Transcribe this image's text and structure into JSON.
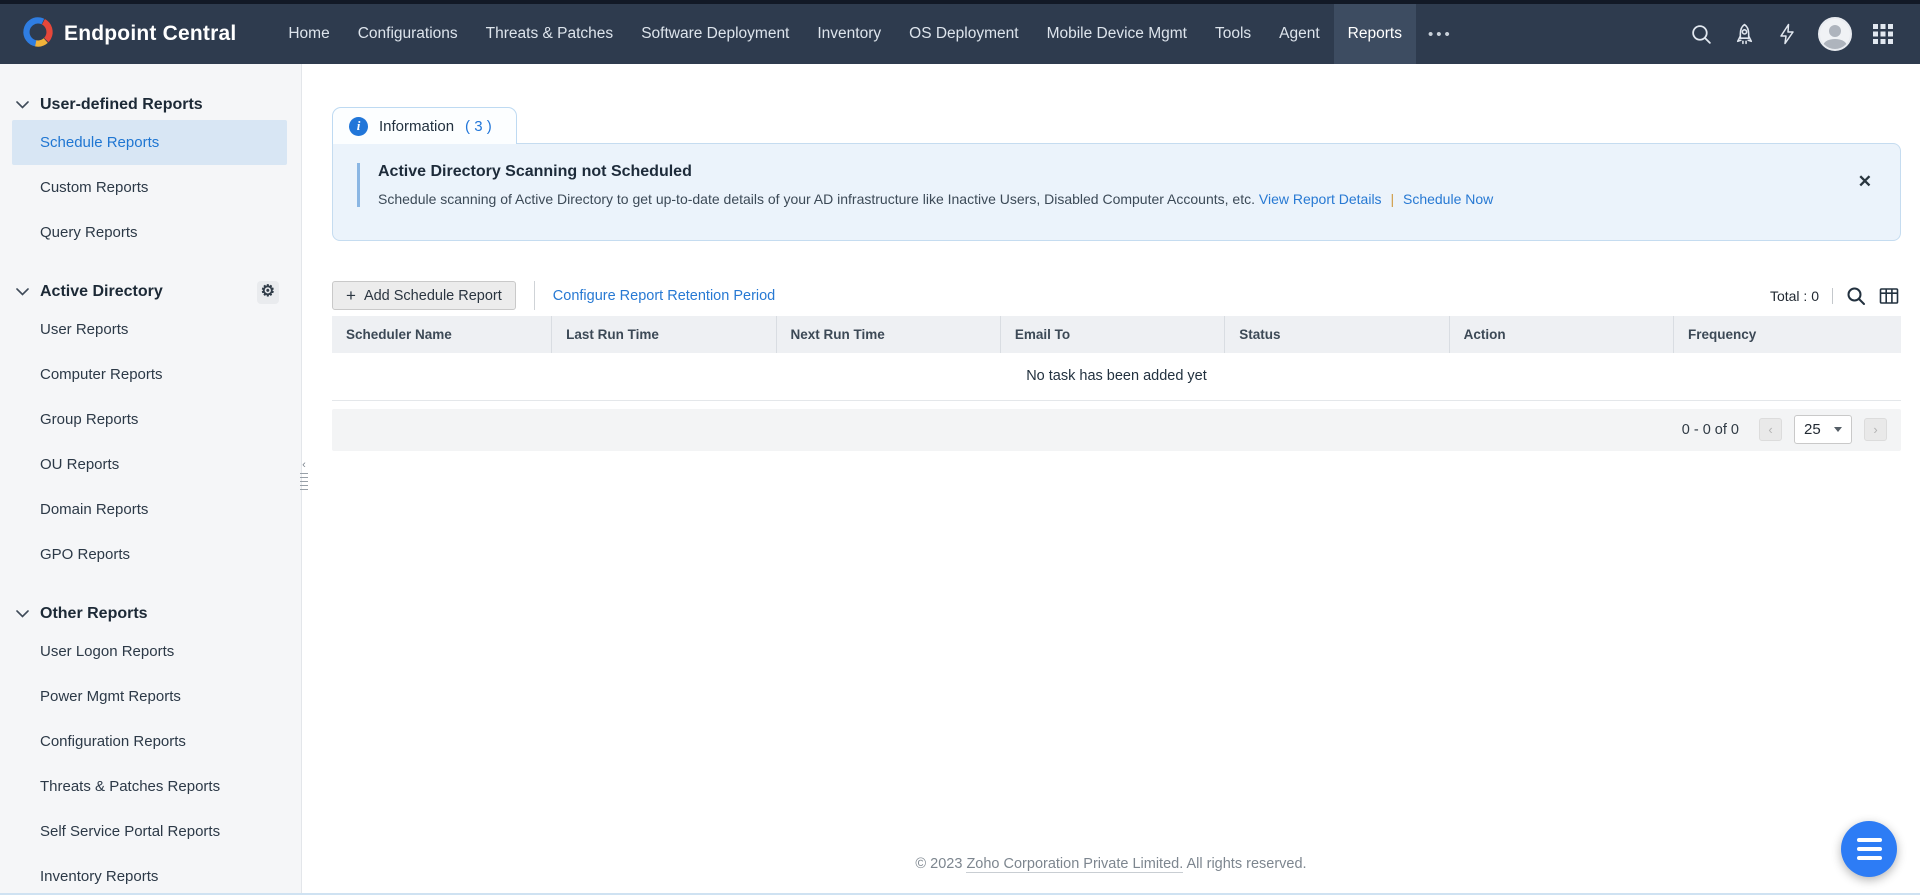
{
  "colors": {
    "nav_bg": "#2e3b4e",
    "nav_active_bg": "#3d4c61",
    "accent_blue": "#2779d3",
    "selected_item_bg": "#d8e6f4",
    "alert_bg": "#ebf3fb",
    "alert_border": "#c5dcf0",
    "info_badge_blue": "#2176d9",
    "fab_blue": "#2d7cf5"
  },
  "nav": {
    "brand": "Endpoint Central",
    "items": [
      {
        "label": "Home"
      },
      {
        "label": "Configurations"
      },
      {
        "label": "Threats & Patches"
      },
      {
        "label": "Software Deployment"
      },
      {
        "label": "Inventory"
      },
      {
        "label": "OS Deployment"
      },
      {
        "label": "Mobile Device Mgmt"
      },
      {
        "label": "Tools"
      },
      {
        "label": "Agent"
      },
      {
        "label": "Reports"
      }
    ],
    "active_item": "Reports",
    "more_label": "•••",
    "icons": [
      "search-icon",
      "rocket-icon",
      "zap-icon",
      "avatar",
      "apps-grid-icon"
    ]
  },
  "sidebar": {
    "selected": "Schedule Reports",
    "sections": [
      {
        "header": "User-defined Reports",
        "items": [
          {
            "label": "Schedule Reports"
          },
          {
            "label": "Custom Reports"
          },
          {
            "label": "Query Reports"
          }
        ]
      },
      {
        "header": "Active Directory",
        "icon": "gear-icon",
        "gear_glyph": "⚙",
        "items": [
          {
            "label": "User Reports"
          },
          {
            "label": "Computer Reports"
          },
          {
            "label": "Group Reports"
          },
          {
            "label": "OU Reports"
          },
          {
            "label": "Domain Reports"
          },
          {
            "label": "GPO Reports"
          }
        ]
      },
      {
        "header": "Other Reports",
        "items": [
          {
            "label": "User Logon Reports"
          },
          {
            "label": "Power Mgmt Reports"
          },
          {
            "label": "Configuration Reports"
          },
          {
            "label": "Threats & Patches Reports"
          },
          {
            "label": "Self Service Portal Reports"
          },
          {
            "label": "Inventory Reports"
          }
        ]
      }
    ]
  },
  "info_tab": {
    "badge": "i",
    "label": "Information",
    "count": "( 3 )"
  },
  "alert": {
    "title": "Active Directory Scanning not Scheduled",
    "description": "Schedule scanning of Active Directory to get up-to-date details of your AD infrastructure like Inactive Users, Disabled Computer Accounts, etc.",
    "link1": "View Report Details",
    "separator": "|",
    "link2": "Schedule Now",
    "close_label": "✕"
  },
  "toolbar": {
    "add_button_icon": "+",
    "add_button_label": "Add Schedule Report",
    "retention_link": "Configure Report Retention Period",
    "total_label": "Total : 0",
    "divider": "|"
  },
  "table": {
    "columns": [
      "Scheduler Name",
      "Last Run Time",
      "Next Run Time",
      "Email To",
      "Status",
      "Action",
      "Frequency"
    ],
    "empty_message": "No task has been added yet"
  },
  "pagination": {
    "range": "0 - 0 of 0",
    "prev": "‹",
    "next": "›",
    "page_size": "25"
  },
  "footer": {
    "copyright": "© 2023",
    "company": "Zoho Corporation Private Limited.",
    "rights": "All rights reserved."
  }
}
